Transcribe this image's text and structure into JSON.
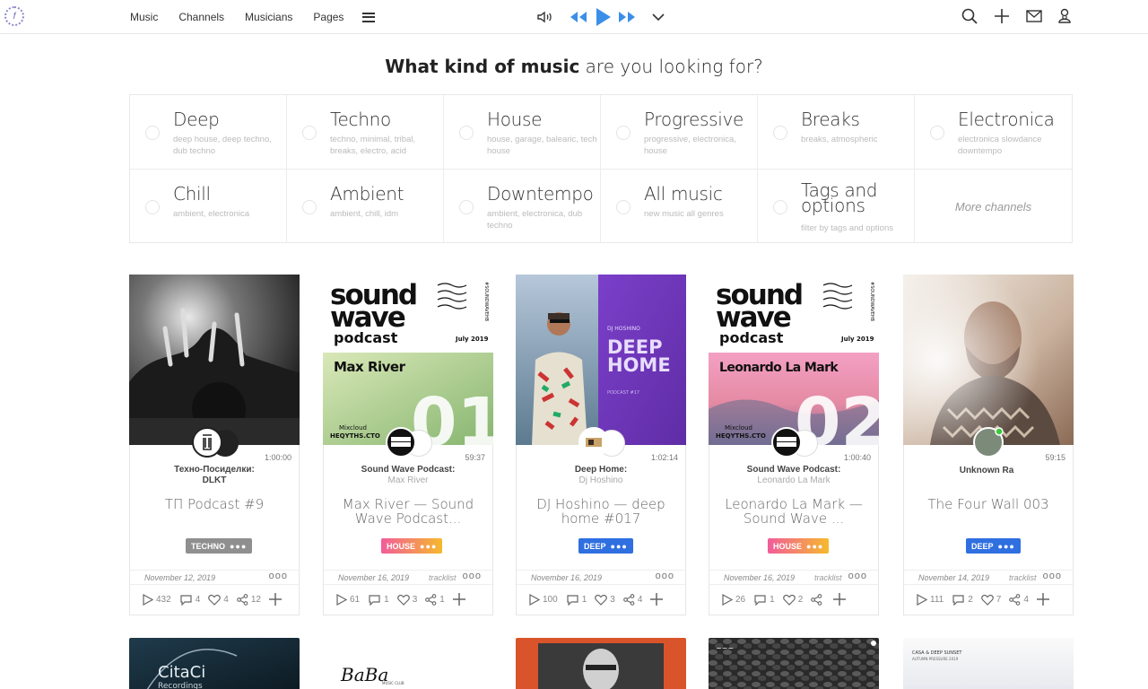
{
  "nav": {
    "items": [
      "Music",
      "Channels",
      "Musicians",
      "Pages"
    ]
  },
  "heading": {
    "bold": "What kind of music",
    "rest": " are you looking for?"
  },
  "channels": [
    {
      "title": "Deep",
      "sub": "deep house, deep techno, dub techno"
    },
    {
      "title": "Techno",
      "sub": "techno, minimal, tribal, breaks, electro, acid"
    },
    {
      "title": "House",
      "sub": "house, garage, balearic, tech house"
    },
    {
      "title": "Progressive",
      "sub": "progressive, electronica, house"
    },
    {
      "title": "Breaks",
      "sub": "breaks, atmospheric"
    },
    {
      "title": "Electronica",
      "sub": "electronica slowdance downtempo"
    },
    {
      "title": "Chill",
      "sub": "ambient, electronica"
    },
    {
      "title": "Ambient",
      "sub": "ambient, chill, idm"
    },
    {
      "title": "Downtempo",
      "sub": "ambient, electronica, dub techno"
    },
    {
      "title": "All music",
      "sub": "new music all genres"
    },
    {
      "title": "Tags and options",
      "sub": "filter by tags and options"
    },
    {
      "title": "More channels",
      "sub": ""
    }
  ],
  "cards": [
    {
      "duration": "1:00:00",
      "artist": "Техно-Посиделки:",
      "artist2": "DLKT",
      "title": "ТП Podcast #9",
      "tag": "TECHNO",
      "date": "November 12, 2019",
      "tracklist": "",
      "plays": "432",
      "comments": "4",
      "likes": "4",
      "shares": "12"
    },
    {
      "duration": "59:37",
      "artist": "Sound Wave Podcast:",
      "artist2": "Max River",
      "title": "Max River — Sound Wave Podcast...",
      "tag": "HOUSE",
      "date": "November 16, 2019",
      "tracklist": "tracklist",
      "plays": "61",
      "comments": "1",
      "likes": "3",
      "shares": "1"
    },
    {
      "duration": "1:02:14",
      "artist": "Deep Home:",
      "artist2": "Dj Hoshino",
      "title": "DJ Hoshino — deep home #017",
      "tag": "DEEP",
      "date": "November 16, 2019",
      "tracklist": "",
      "plays": "100",
      "comments": "1",
      "likes": "3",
      "shares": "4"
    },
    {
      "duration": "1:00:40",
      "artist": "Sound Wave Podcast:",
      "artist2": "Leonardo La Mark",
      "title": "Leonardo La Mark — Sound Wave ...",
      "tag": "HOUSE",
      "date": "November 16, 2019",
      "tracklist": "tracklist",
      "plays": "26",
      "comments": "1",
      "likes": "2",
      "shares": ""
    },
    {
      "duration": "59:15",
      "artist": "Unknown Ra",
      "artist2": "",
      "title": "The Four Wall 003",
      "tag": "DEEP",
      "date": "November 14, 2019",
      "tracklist": "tracklist",
      "plays": "111",
      "comments": "2",
      "likes": "7",
      "shares": "4"
    }
  ],
  "covers": {
    "sw1": {
      "brand1": "sound",
      "brand2": "wave",
      "brand3": "podcast",
      "month": "July 2019",
      "name": "Max River",
      "num": "01",
      "mix": "Mixcloud",
      "site": "HEQYTHS.CTO",
      "side": "#SOUNDWAVEHB"
    },
    "sw2": {
      "brand1": "sound",
      "brand2": "wave",
      "brand3": "podcast",
      "month": "July 2019",
      "name": "Leonardo La Mark",
      "num": "02",
      "mix": "Mixcloud",
      "site": "HEQYTHS.CTO",
      "side": "#SOUNDWAVEHB"
    },
    "dh": {
      "dj": "DJ HOSHINO",
      "line1": "DEEP",
      "line2": "HOME",
      "pod": "PODCAST #17"
    },
    "bottom": {
      "citaci1": "CitaCi",
      "citaci2": "Recordings",
      "baba": "BaBa",
      "baba2": "MUSIC CLUB",
      "last": "CASA & DEEP SUNSET",
      "last2": "AUTUMN PRESSURE 2019"
    }
  },
  "colors": {
    "techno": "#9a9a9a",
    "house": "#f06d9a",
    "deep": "#2f6fe0",
    "accent": "#3b8fe8"
  }
}
